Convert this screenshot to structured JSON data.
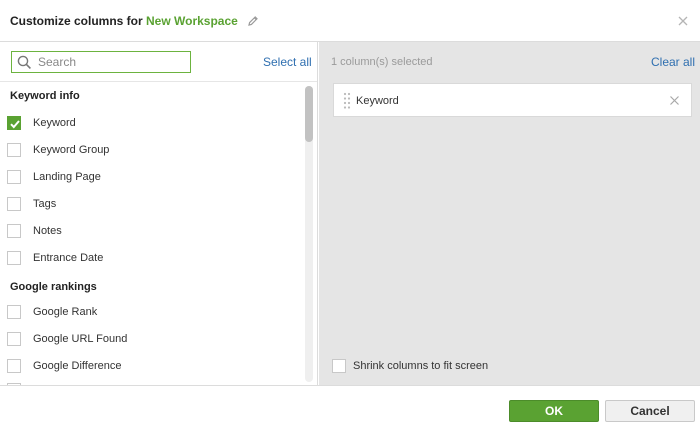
{
  "header": {
    "title_prefix": "Customize columns for ",
    "workspace_name": "New Workspace"
  },
  "search": {
    "placeholder": "Search",
    "value": ""
  },
  "left_panel": {
    "select_all_label": "Select all",
    "groups": [
      {
        "title": "Keyword info",
        "items": [
          {
            "label": "Keyword",
            "checked": true
          },
          {
            "label": "Keyword Group",
            "checked": false
          },
          {
            "label": "Landing Page",
            "checked": false
          },
          {
            "label": "Tags",
            "checked": false
          },
          {
            "label": "Notes",
            "checked": false
          },
          {
            "label": "Entrance Date",
            "checked": false
          }
        ]
      },
      {
        "title": "Google rankings",
        "items": [
          {
            "label": "Google Rank",
            "checked": false
          },
          {
            "label": "Google URL Found",
            "checked": false
          },
          {
            "label": "Google Difference",
            "checked": false
          },
          {
            "label": "",
            "checked": false
          }
        ]
      }
    ]
  },
  "right_panel": {
    "selected_count_text": "1 column(s) selected",
    "clear_all_label": "Clear all",
    "selected_columns": [
      {
        "label": "Keyword"
      }
    ],
    "shrink_label": "Shrink columns to fit screen",
    "shrink_checked": false
  },
  "footer": {
    "ok_label": "OK",
    "cancel_label": "Cancel"
  },
  "colors": {
    "accent_green": "#5aa232",
    "link_blue": "#2f6fb0",
    "right_panel_bg": "#e5e5e5"
  },
  "icons": {
    "edit": "pencil-icon",
    "close": "close-icon",
    "search": "search-icon",
    "check": "checkmark-icon",
    "drag": "drag-handle-icon",
    "remove": "remove-icon"
  }
}
